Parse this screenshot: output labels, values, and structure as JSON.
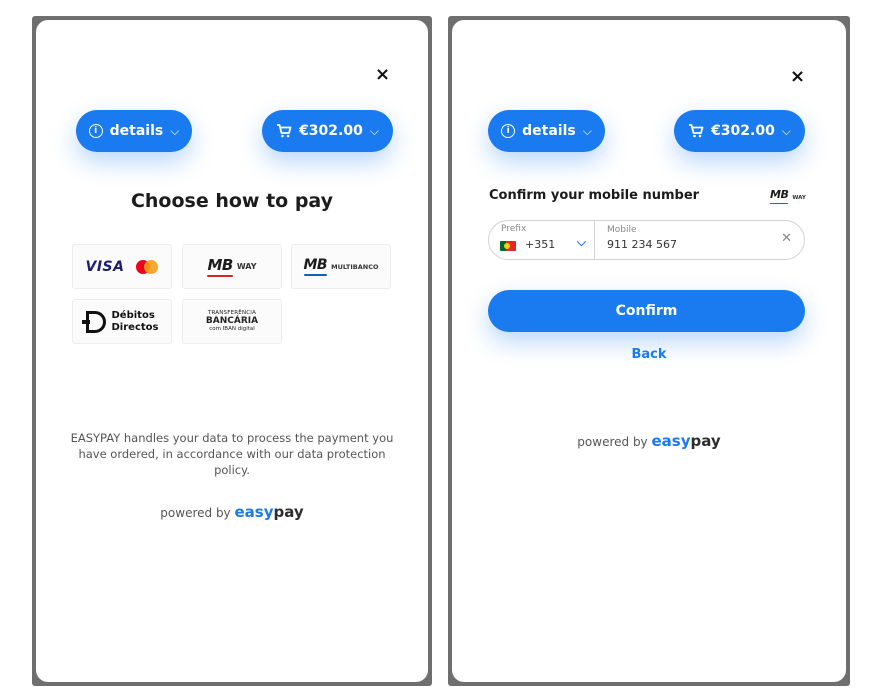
{
  "left_panel": {
    "close_label": "×",
    "details_label": "details",
    "cart_amount": "€302.00",
    "title": "Choose how to pay",
    "methods": {
      "visa": "VISA",
      "mbway_mb": "MB",
      "mbway_sub": "WAY",
      "multibanco_mb": "MB",
      "multibanco_sub": "MULTIBANCO",
      "debitos_line1": "Débitos",
      "debitos_line2": "Directos",
      "transfer_line1": "TRANSFERÊNCIA",
      "transfer_line2": "BANCÁRIA",
      "transfer_line3": "com IBAN digital"
    },
    "disclaimer": "EASYPAY handles your data to process the payment you have ordered, in accordance with our data protection policy.",
    "powered_by": "powered by",
    "brand_easy": "easy",
    "brand_pay": "pay"
  },
  "right_panel": {
    "close_label": "×",
    "details_label": "details",
    "cart_amount": "€302.00",
    "confirm_label": "Confirm your mobile number",
    "mbway_mb": "MB",
    "mbway_sub": "WAY",
    "prefix_label": "Prefix",
    "prefix_value": "+351",
    "mobile_label": "Mobile",
    "mobile_value": "911 234 567",
    "confirm_button": "Confirm",
    "back_link": "Back",
    "powered_by": "powered by",
    "brand_easy": "easy",
    "brand_pay": "pay"
  },
  "colors": {
    "accent": "#1a7aef",
    "frame": "#6f6f6f",
    "mb_red": "#d6242a"
  },
  "icons": {
    "close": "close-icon",
    "info": "info-icon",
    "cart": "cart-icon",
    "chevron": "chevron-down-icon",
    "clear": "clear-icon",
    "flag": "portugal-flag-icon"
  }
}
